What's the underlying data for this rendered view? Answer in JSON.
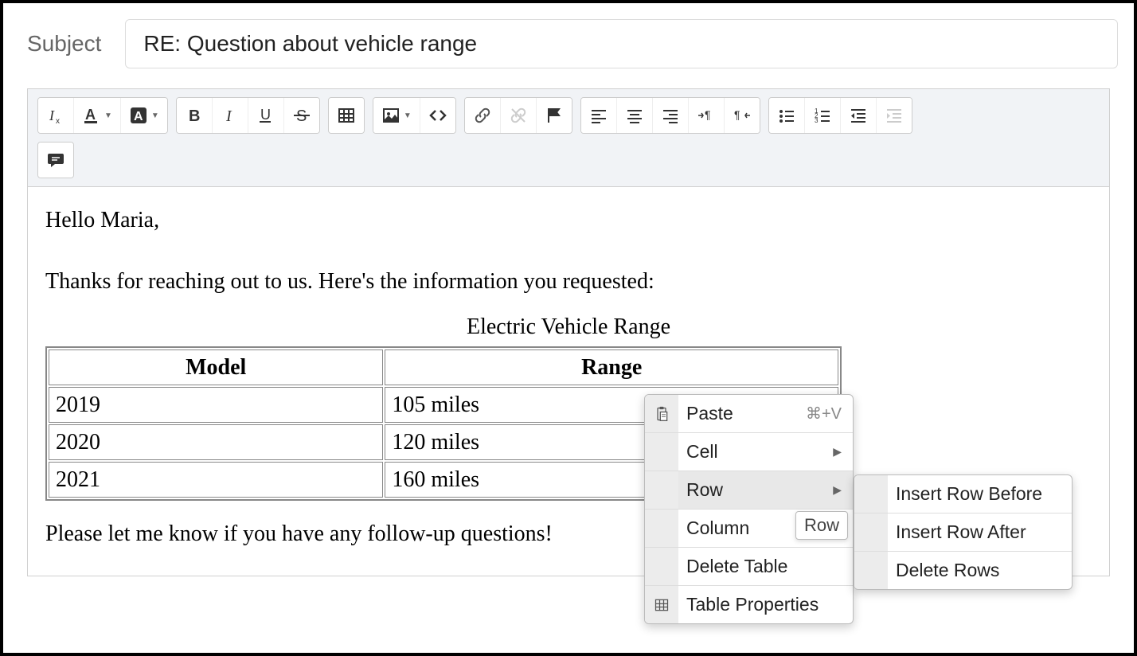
{
  "subject": {
    "label": "Subject",
    "value": "RE: Question about vehicle range"
  },
  "toolbar": {
    "groups": [
      [
        "clear-format",
        "text-color",
        "bg-color"
      ],
      [
        "bold",
        "italic",
        "underline",
        "strike"
      ],
      [
        "table"
      ],
      [
        "image",
        "code"
      ],
      [
        "link",
        "unlink",
        "flag"
      ],
      [
        "align-left",
        "align-center",
        "align-right",
        "ltr",
        "rtl"
      ],
      [
        "bullet-list",
        "number-list",
        "indent-left",
        "indent-right"
      ]
    ],
    "second_row": [
      "comment"
    ]
  },
  "body": {
    "greeting": "Hello Maria,",
    "intro": "Thanks for reaching out to us. Here's the information you requested:",
    "closing": "Please let me know if you have any follow-up questions!",
    "table": {
      "caption": "Electric Vehicle Range",
      "headers": [
        "Model",
        "Range"
      ],
      "rows": [
        [
          "2019",
          "105 miles"
        ],
        [
          "2020",
          "120 miles"
        ],
        [
          "2021",
          "160 miles"
        ]
      ]
    }
  },
  "context_menu": {
    "items": [
      {
        "label": "Paste",
        "shortcut": "⌘+V",
        "icon": "paste"
      },
      {
        "label": "Cell",
        "arrow": true
      },
      {
        "label": "Row",
        "arrow": true,
        "highlighted": true
      },
      {
        "label": "Column"
      },
      {
        "label": "Delete Table"
      },
      {
        "label": "Table Properties",
        "icon": "table"
      }
    ],
    "tooltip": "Row"
  },
  "submenu": {
    "items": [
      {
        "label": "Insert Row Before"
      },
      {
        "label": "Insert Row After"
      },
      {
        "label": "Delete Rows"
      }
    ]
  }
}
